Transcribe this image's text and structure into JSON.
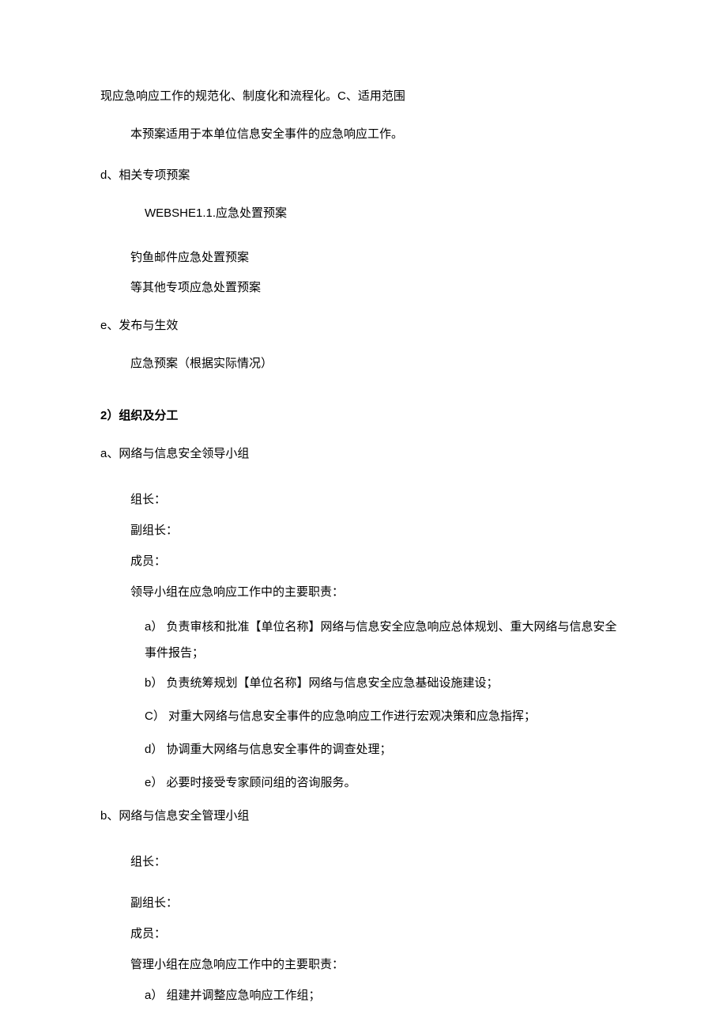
{
  "intro": {
    "line1": "现应急响应工作的规范化、制度化和流程化。C、适用范围",
    "line2": "本预案适用于本单位信息安全事件的应急响应工作。"
  },
  "section_d": {
    "label": "d、相关专项预案",
    "items": [
      "WEBSHE1.1.应急处置预案",
      "钓鱼邮件应急处置预案",
      "等其他专项应急处置预案"
    ]
  },
  "section_e": {
    "label": "e、发布与生效",
    "content": "应急预案（根据实际情况）"
  },
  "heading2": "2）组织及分工",
  "group_a": {
    "label": "a、网络与信息安全领导小组",
    "leader": "组长：",
    "vice": "副组长：",
    "members": "成员：",
    "duties_intro": "领导小组在应急响应工作中的主要职责：",
    "duties": [
      {
        "marker": "a）",
        "text": "负责审核和批准【单位名称】网络与信息安全应急响应总体规划、重大网络与信息安全事件报告；"
      },
      {
        "marker": "b）",
        "text": "负责统筹规划【单位名称】网络与信息安全应急基础设施建设；"
      },
      {
        "marker": "C）",
        "text": "对重大网络与信息安全事件的应急响应工作进行宏观决策和应急指挥；"
      },
      {
        "marker": "d）",
        "text": "协调重大网络与信息安全事件的调查处理；"
      },
      {
        "marker": "e）",
        "text": "必要时接受专家顾问组的咨询服务。"
      }
    ]
  },
  "group_b": {
    "label": "b、网络与信息安全管理小组",
    "leader": "组长：",
    "vice": "副组长：",
    "members": "成员：",
    "duties_intro": "管理小组在应急响应工作中的主要职责：",
    "duties": [
      {
        "marker": "a）",
        "text": "组建并调整应急响应工作组；"
      }
    ]
  }
}
